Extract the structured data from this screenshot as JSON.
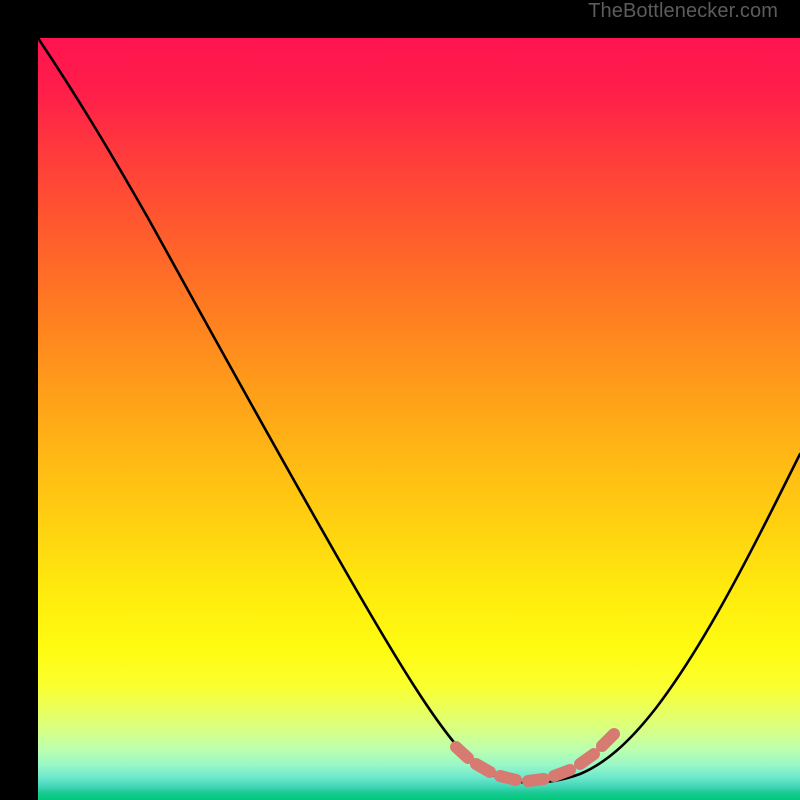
{
  "watermark": "TheBottlenecker.com",
  "chart_data": {
    "type": "line",
    "title": "",
    "xlabel": "",
    "ylabel": "",
    "xlim": [
      0,
      100
    ],
    "ylim": [
      0,
      100
    ],
    "background_gradient": {
      "orientation": "vertical",
      "stops": [
        {
          "pos": 0,
          "color": "#ff1450"
        },
        {
          "pos": 0.5,
          "color": "#ffb814"
        },
        {
          "pos": 0.85,
          "color": "#fbff30"
        },
        {
          "pos": 1.0,
          "color": "#00c878"
        }
      ]
    },
    "series": [
      {
        "name": "bottleneck-curve",
        "color": "#000000",
        "x": [
          0,
          5,
          10,
          15,
          20,
          25,
          30,
          35,
          40,
          45,
          50,
          55,
          58,
          60,
          63,
          66,
          70,
          74,
          78,
          82,
          86,
          90,
          94,
          98,
          100
        ],
        "y": [
          100,
          94,
          87,
          80,
          73,
          65,
          57,
          49,
          41,
          33,
          25,
          16,
          10,
          7,
          4,
          3,
          3,
          4,
          7,
          13,
          22,
          32,
          43,
          54,
          60
        ]
      },
      {
        "name": "highlight-band",
        "color": "#d77a72",
        "style": "thick-dashed",
        "x": [
          56,
          58,
          60,
          62,
          64,
          66,
          68,
          70,
          72,
          74,
          76,
          78
        ],
        "y": [
          10,
          8,
          6,
          5,
          4,
          4,
          4,
          4,
          5,
          6,
          8,
          10
        ]
      }
    ]
  }
}
